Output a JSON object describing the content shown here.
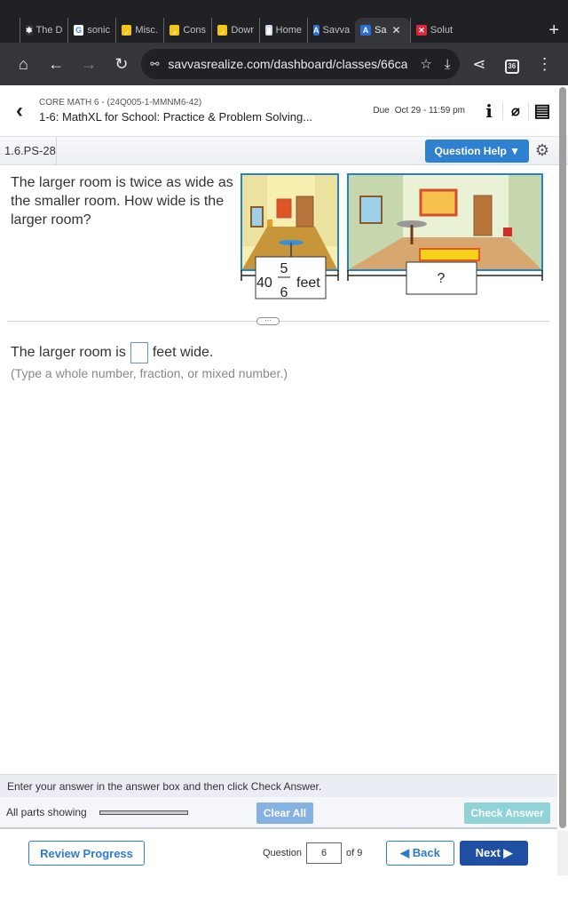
{
  "browser": {
    "tabs": [
      {
        "label": "The D",
        "icon": "bookmark-star-icon",
        "icon_color": "#333",
        "icon_glyph": "✱"
      },
      {
        "label": "sonic",
        "icon": "google-icon",
        "icon_color": "#fff",
        "icon_glyph": "G"
      },
      {
        "label": "Misc.",
        "icon": "banana-icon",
        "icon_color": "#f5c518",
        "icon_glyph": "◞"
      },
      {
        "label": "Cons",
        "icon": "banana-icon",
        "icon_color": "#f5c518",
        "icon_glyph": "◞"
      },
      {
        "label": "Dowr",
        "icon": "banana-icon",
        "icon_color": "#f5c518",
        "icon_glyph": "◞"
      },
      {
        "label": "Home",
        "icon": "doc-icon",
        "icon_color": "#cfd8e6",
        "icon_glyph": "▮"
      },
      {
        "label": "Savva",
        "icon": "savvas-icon",
        "icon_color": "#2a6fd6",
        "icon_glyph": "A"
      },
      {
        "label": "Sa",
        "icon": "savvas-icon",
        "icon_color": "#2a6fd6",
        "icon_glyph": "A",
        "active": true
      },
      {
        "label": "Solut",
        "icon": "x-brand-icon",
        "icon_color": "#e0243a",
        "icon_glyph": "✕"
      }
    ],
    "url": "savvasrealize.com/dashboard/classes/66ca",
    "tab_count": "36"
  },
  "header": {
    "course": "CORE MATH 6 - (24Q005-1-MMNM6-42)",
    "assignment": "1-6: MathXL for School: Practice & Problem Solving...",
    "due_label": "Due",
    "due_value": "Oct 29 - 11:59 pm"
  },
  "question_bar": {
    "id": "1.6.PS-28",
    "help_label": "Question Help ▼"
  },
  "question": {
    "text": "The larger room is twice as wide as the smaller room. How wide is the larger room?",
    "small_room": {
      "whole": "40",
      "numerator": "5",
      "denominator": "6",
      "unit": "feet"
    },
    "large_room_label": "?",
    "answer_prefix": "The larger room is",
    "answer_value": "",
    "answer_suffix": "feet wide.",
    "hint": "(Type a whole number, fraction, or mixed number.)",
    "expand_label": "···"
  },
  "instructions": "Enter your answer in the answer box and then click Check Answer.",
  "actions": {
    "parts_label": "All parts showing",
    "clear_all": "Clear All",
    "check_answer": "Check Answer"
  },
  "footer": {
    "review_progress": "Review Progress",
    "question_label": "Question",
    "question_number": "6",
    "of_total": "of 9",
    "back": "◀ Back",
    "next": "Next ▶"
  }
}
